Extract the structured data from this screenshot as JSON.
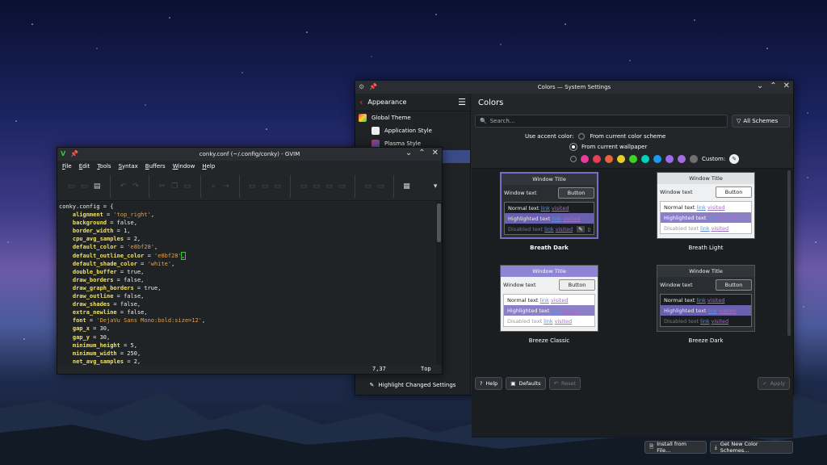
{
  "settings_window": {
    "title": "Colors — System Settings",
    "sidebar": {
      "back_label": "Appearance",
      "items": [
        {
          "label": "Global Theme"
        },
        {
          "label": "Application Style"
        },
        {
          "label": "Plasma Style"
        }
      ],
      "highlight_button": "Highlight Changed Settings"
    },
    "page_title": "Colors",
    "search_placeholder": "Search...",
    "filter_label": "All Schemes",
    "accent": {
      "label": "Use accent color:",
      "option1": "From current color scheme",
      "option2": "From current wallpaper",
      "custom_label": "Custom:",
      "swatches": [
        "#e93a9a",
        "#e93d58",
        "#e9643a",
        "#e8cb2d",
        "#3dd425",
        "#00d3b8",
        "#1d99f3",
        "#9d6bed",
        "#a56be0",
        "#707070"
      ]
    },
    "schemes": [
      {
        "name": "Breath Dark",
        "title": "Window Title",
        "window_text": "Window text",
        "button": "Button",
        "normal": "Normal text",
        "highlighted": "Highlighted text",
        "disabled": "Disabled text",
        "link": "link",
        "visited": "visited"
      },
      {
        "name": "Breath Light",
        "title": "Window Title",
        "window_text": "Window text",
        "button": "Button",
        "normal": "Normal text",
        "highlighted": "Highlighted text",
        "disabled": "Disabled text",
        "link": "link",
        "visited": "visited"
      },
      {
        "name": "Breeze Classic",
        "title": "Window Title",
        "window_text": "Window text",
        "button": "Button",
        "normal": "Normal text",
        "highlighted": "Highlighted text",
        "disabled": "Disabled text",
        "link": "link",
        "visited": "visited"
      },
      {
        "name": "Breeze Dark",
        "title": "Window Title",
        "window_text": "Window text",
        "button": "Button",
        "normal": "Normal text",
        "highlighted": "Highlighted text",
        "disabled": "Disabled text",
        "link": "link",
        "visited": "visited"
      }
    ],
    "install_label": "Install from File...",
    "get_new_label": "Get New Color Schemes...",
    "help_label": "Help",
    "defaults_label": "Defaults",
    "reset_label": "Reset",
    "apply_label": "Apply"
  },
  "gvim_window": {
    "title": "conky.conf (~/.config/conky) - GVIM",
    "menu": [
      "File",
      "Edit",
      "Tools",
      "Syntax",
      "Buffers",
      "Window",
      "Help"
    ],
    "lines": [
      {
        "key": "",
        "val": "conky.config = {"
      },
      {
        "key": "alignment",
        "val": " = 'top_right',"
      },
      {
        "key": "background",
        "val": " = false,"
      },
      {
        "key": "border_width",
        "val": " = 1,"
      },
      {
        "key": "cpu_avg_samples",
        "val": " = 2,"
      },
      {
        "key": "default_color",
        "val": " = 'e8bf28',"
      },
      {
        "key": "default_outline_color",
        "val": " = 'e8bf28',"
      },
      {
        "key": "default_shade_color",
        "val": " = 'white',"
      },
      {
        "key": "double_buffer",
        "val": " = true,"
      },
      {
        "key": "draw_borders",
        "val": " = false,"
      },
      {
        "key": "draw_graph_borders",
        "val": " = true,"
      },
      {
        "key": "draw_outline",
        "val": " = false,"
      },
      {
        "key": "draw_shades",
        "val": " = false,"
      },
      {
        "key": "extra_newline",
        "val": " = false,"
      },
      {
        "key": "font",
        "val": " = 'DejaVu Sans Mono:bold:size=12',"
      },
      {
        "key": "gap_x",
        "val": " = 30,"
      },
      {
        "key": "gap_y",
        "val": " = 30,"
      },
      {
        "key": "minimum_height",
        "val": " = 5,"
      },
      {
        "key": "minimum_width",
        "val": " = 250,"
      },
      {
        "key": "net_avg_samples",
        "val": " = 2,"
      }
    ],
    "cursor_pos": "7,37",
    "scroll_pos": "Top"
  }
}
